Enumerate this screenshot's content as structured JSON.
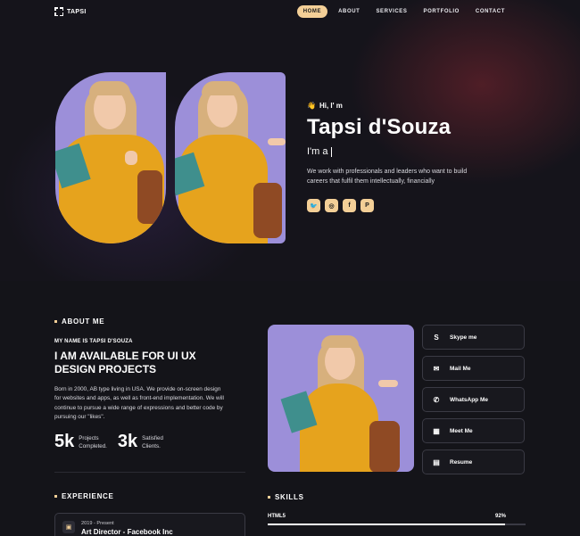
{
  "nav": {
    "logo": "TAPSI",
    "items": [
      {
        "label": "HOME",
        "active": true
      },
      {
        "label": "ABOUT"
      },
      {
        "label": "SERVICES"
      },
      {
        "label": "PORTFOLIO"
      },
      {
        "label": "CONTACT"
      }
    ]
  },
  "hero": {
    "greeting": "Hi, I' m",
    "greeting_icon": "waving-hand-icon",
    "name": "Tapsi d'Souza",
    "role_prefix": "I'm a",
    "description": "We work with professionals and leaders who want to build careers that fulfil them intellectually, financially",
    "socials": [
      {
        "icon": "twitter-icon",
        "glyph": "🐦"
      },
      {
        "icon": "instagram-icon",
        "glyph": "◎"
      },
      {
        "icon": "facebook-icon",
        "glyph": "f"
      },
      {
        "icon": "pinterest-icon",
        "glyph": "P"
      }
    ]
  },
  "about": {
    "title": "ABOUT ME",
    "subtitle": "MY NAME IS TAPSI D'SOUZA",
    "heading": "I AM AVAILABLE FOR UI UX DESIGN PROJECTS",
    "body": "Born in 2000, AB type living in USA. We provide on-screen design for websites and apps, as well as front-end implementation. We will continue to pursue a wide range of expressions and better code by pursuing our \"likes\".",
    "stats": [
      {
        "value": "5k",
        "label_line1": "Projects",
        "label_line2": "Completed."
      },
      {
        "value": "3k",
        "label_line1": "Satisfied",
        "label_line2": "Clients."
      }
    ]
  },
  "contacts": [
    {
      "label": "Skype me",
      "icon": "skype-icon",
      "glyph": "S"
    },
    {
      "label": "Mail Me",
      "icon": "mail-icon",
      "glyph": "✉"
    },
    {
      "label": "WhatsApp Me",
      "icon": "whatsapp-icon",
      "glyph": "✆"
    },
    {
      "label": "Meet Me",
      "icon": "map-icon",
      "glyph": "▦"
    },
    {
      "label": "Resume",
      "icon": "file-icon",
      "glyph": "▤"
    }
  ],
  "experience": {
    "title": "EXPERIENCE",
    "items": [
      {
        "date": "2019 - Present",
        "role": "Art Director - Facebook Inc",
        "icon": "briefcase-icon"
      }
    ]
  },
  "skills": {
    "title": "SKILLS",
    "items": [
      {
        "name": "HTML5",
        "percent_label": "92%",
        "value": 0.92
      }
    ]
  },
  "colors": {
    "accent": "#f3cf97",
    "background": "#141419",
    "card_border": "#3a3a44"
  }
}
